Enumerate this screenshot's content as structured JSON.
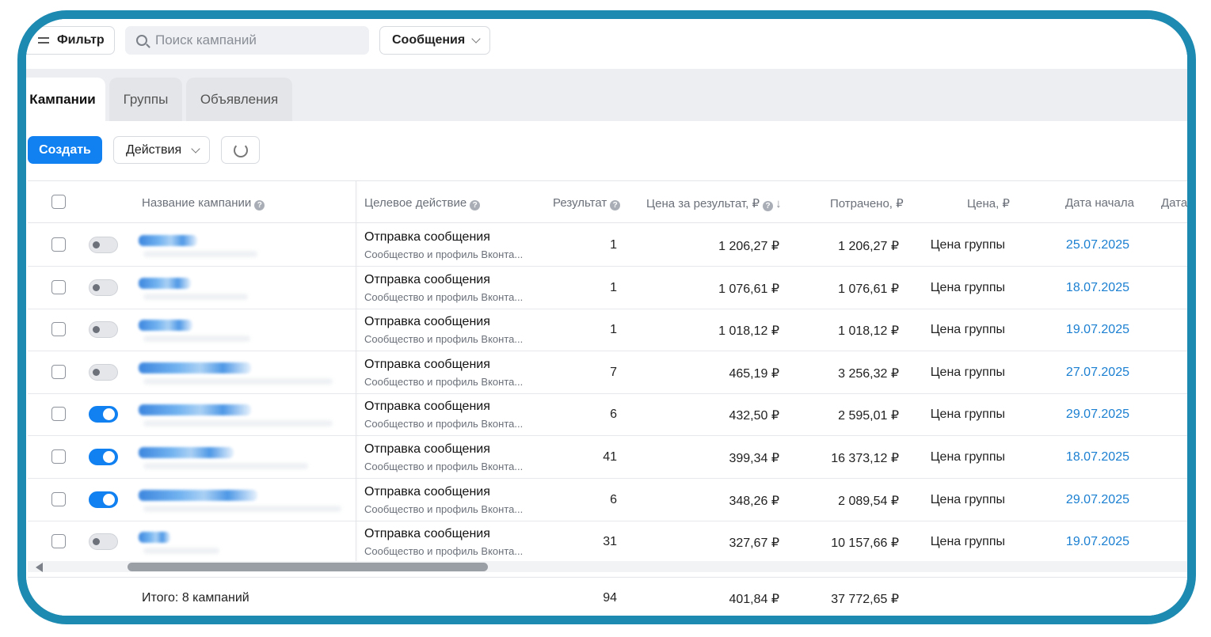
{
  "toolbar": {
    "filter_label": "Фильтр",
    "search_placeholder": "Поиск кампаний",
    "type_select": "Сообщения",
    "create_label": "Создать",
    "actions_label": "Действия"
  },
  "tabs": [
    {
      "label": "Кампании",
      "active": true
    },
    {
      "label": "Группы",
      "active": false
    },
    {
      "label": "Объявления",
      "active": false
    }
  ],
  "table": {
    "headers": {
      "name": "Название кампании",
      "goal": "Целевое действие",
      "result": "Результат",
      "cost_per_result": "Цена за результат, ₽",
      "spent": "Потрачено, ₽",
      "price": "Цена, ₽",
      "start_date": "Дата начала",
      "end_date": "Дата"
    },
    "rows": [
      {
        "active": false,
        "goal": "Отправка сообщения",
        "goal_sub": "Сообщество и профиль Вконта...",
        "result": "1",
        "cost": "1 206,27 ₽",
        "spent": "1 206,27 ₽",
        "price": "Цена группы",
        "date": "25.07.2025"
      },
      {
        "active": false,
        "goal": "Отправка сообщения",
        "goal_sub": "Сообщество и профиль Вконта...",
        "result": "1",
        "cost": "1 076,61 ₽",
        "spent": "1 076,61 ₽",
        "price": "Цена группы",
        "date": "18.07.2025"
      },
      {
        "active": false,
        "goal": "Отправка сообщения",
        "goal_sub": "Сообщество и профиль Вконта...",
        "result": "1",
        "cost": "1 018,12 ₽",
        "spent": "1 018,12 ₽",
        "price": "Цена группы",
        "date": "19.07.2025"
      },
      {
        "active": false,
        "goal": "Отправка сообщения",
        "goal_sub": "Сообщество и профиль Вконта...",
        "result": "7",
        "cost": "465,19 ₽",
        "spent": "3 256,32 ₽",
        "price": "Цена группы",
        "date": "27.07.2025"
      },
      {
        "active": true,
        "goal": "Отправка сообщения",
        "goal_sub": "Сообщество и профиль Вконта...",
        "result": "6",
        "cost": "432,50 ₽",
        "spent": "2 595,01 ₽",
        "price": "Цена группы",
        "date": "29.07.2025"
      },
      {
        "active": true,
        "goal": "Отправка сообщения",
        "goal_sub": "Сообщество и профиль Вконта...",
        "result": "41",
        "cost": "399,34 ₽",
        "spent": "16 373,12 ₽",
        "price": "Цена группы",
        "date": "18.07.2025"
      },
      {
        "active": true,
        "goal": "Отправка сообщения",
        "goal_sub": "Сообщество и профиль Вконта...",
        "result": "6",
        "cost": "348,26 ₽",
        "spent": "2 089,54 ₽",
        "price": "Цена группы",
        "date": "29.07.2025"
      },
      {
        "active": false,
        "goal": "Отправка сообщения",
        "goal_sub": "Сообщество и профиль Вконта...",
        "result": "31",
        "cost": "327,67 ₽",
        "spent": "10 157,66 ₽",
        "price": "Цена группы",
        "date": "19.07.2025"
      }
    ],
    "totals": {
      "label": "Итого: 8 кампаний",
      "result": "94",
      "cost": "401,84 ₽",
      "spent": "37 772,65 ₽"
    }
  },
  "icons": {
    "help": "question-circle-icon",
    "sort": "arrow-down-icon",
    "refresh": "refresh-icon"
  },
  "colors": {
    "frame": "#1d8ab2",
    "primary": "#1180f1",
    "date_link": "#1a7fd1"
  }
}
